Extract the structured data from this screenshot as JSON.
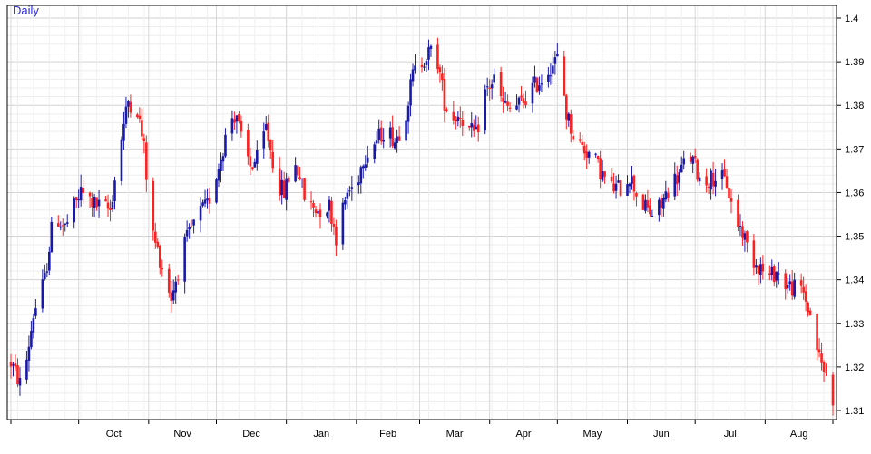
{
  "chart_data": {
    "type": "candlestick",
    "series_label": "Daily",
    "x_tick_labels": [
      "Oct",
      "Nov",
      "Dec",
      "Jan",
      "Feb",
      "Mar",
      "Apr",
      "May",
      "Jun",
      "Jul",
      "Aug"
    ],
    "y_tick_labels": [
      "1.4",
      "1.39",
      "1.38",
      "1.37",
      "1.36",
      "1.35",
      "1.34",
      "1.33",
      "1.32",
      "1.31"
    ],
    "ylim": [
      1.308,
      1.4
    ],
    "y_axis_side": "right",
    "grid": true,
    "colors": {
      "up": "#1a1aaa",
      "down": "#ff2020",
      "label": "#2b2bd6",
      "grid": "#e3e3e3",
      "axis": "#000000"
    },
    "close_path": [
      [
        0,
        1.321
      ],
      [
        5,
        1.315
      ],
      [
        10,
        1.332
      ],
      [
        15,
        1.34
      ],
      [
        19,
        1.355
      ],
      [
        24,
        1.352
      ],
      [
        31,
        1.36
      ],
      [
        38,
        1.357
      ],
      [
        44,
        1.356
      ],
      [
        48,
        1.37
      ],
      [
        52,
        1.381
      ],
      [
        56,
        1.379
      ],
      [
        59,
        1.37
      ],
      [
        62,
        1.352
      ],
      [
        67,
        1.343
      ],
      [
        71,
        1.336
      ],
      [
        77,
        1.348
      ],
      [
        83,
        1.355
      ],
      [
        87,
        1.357
      ],
      [
        92,
        1.366
      ],
      [
        97,
        1.377
      ],
      [
        100,
        1.378
      ],
      [
        102,
        1.372
      ],
      [
        106,
        1.366
      ],
      [
        110,
        1.368
      ],
      [
        113,
        1.375
      ],
      [
        118,
        1.362
      ],
      [
        121,
        1.36
      ],
      [
        125,
        1.367
      ],
      [
        128,
        1.364
      ],
      [
        131,
        1.356
      ],
      [
        133,
        1.357
      ],
      [
        136,
        1.356
      ],
      [
        141,
        1.357
      ],
      [
        144,
        1.35
      ],
      [
        149,
        1.36
      ],
      [
        153,
        1.362
      ],
      [
        156,
        1.368
      ],
      [
        159,
        1.37
      ],
      [
        162,
        1.372
      ],
      [
        166,
        1.375
      ],
      [
        170,
        1.372
      ],
      [
        174,
        1.376
      ],
      [
        178,
        1.387
      ],
      [
        183,
        1.391
      ],
      [
        188,
        1.393
      ],
      [
        192,
        1.381
      ],
      [
        195,
        1.377
      ],
      [
        199,
        1.378
      ],
      [
        203,
        1.374
      ],
      [
        206,
        1.373
      ],
      [
        210,
        1.383
      ],
      [
        214,
        1.386
      ],
      [
        218,
        1.38
      ],
      [
        222,
        1.379
      ],
      [
        227,
        1.381
      ],
      [
        231,
        1.384
      ],
      [
        235,
        1.386
      ],
      [
        239,
        1.389
      ],
      [
        243,
        1.391
      ],
      [
        246,
        1.378
      ],
      [
        250,
        1.372
      ],
      [
        254,
        1.37
      ],
      [
        258,
        1.368
      ],
      [
        262,
        1.364
      ],
      [
        266,
        1.361
      ],
      [
        270,
        1.361
      ],
      [
        274,
        1.364
      ],
      [
        277,
        1.36
      ],
      [
        280,
        1.357
      ],
      [
        284,
        1.355
      ],
      [
        288,
        1.357
      ],
      [
        292,
        1.362
      ],
      [
        296,
        1.364
      ],
      [
        300,
        1.369
      ],
      [
        303,
        1.366
      ],
      [
        306,
        1.362
      ],
      [
        309,
        1.363
      ],
      [
        313,
        1.364
      ],
      [
        317,
        1.362
      ],
      [
        320,
        1.355
      ],
      [
        324,
        1.351
      ],
      [
        328,
        1.345
      ],
      [
        332,
        1.343
      ],
      [
        335,
        1.34
      ],
      [
        339,
        1.342
      ],
      [
        343,
        1.339
      ],
      [
        347,
        1.338
      ],
      [
        351,
        1.337
      ],
      [
        355,
        1.33
      ],
      [
        358,
        1.322
      ],
      [
        361,
        1.318
      ],
      [
        364,
        1.313
      ]
    ]
  }
}
